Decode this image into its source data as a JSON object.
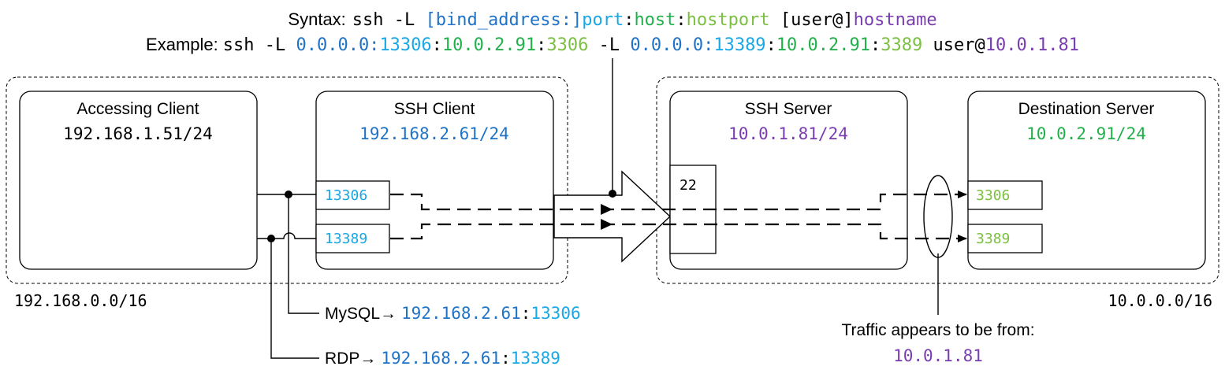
{
  "syntax": {
    "label": "Syntax:",
    "cmd": "ssh -L ",
    "bind_address": "[bind_address:]",
    "port": "port",
    "sep1": ":",
    "host": "host",
    "sep2": ":",
    "hostport": "hostport",
    "user": " [user@]",
    "hostname": "hostname"
  },
  "example": {
    "label": "Example:",
    "cmd1": "ssh -L ",
    "bind1": "0.0.0.0:",
    "port1": "13306",
    "sep1a": ":",
    "host1": "10.0.2.91",
    "sep1b": ":",
    "hostport1": "3306",
    "cmd2": " -L ",
    "bind2": "0.0.0.0:",
    "port2": "13389",
    "sep2a": ":",
    "host2": "10.0.2.91",
    "sep2b": ":",
    "hostport2": "3389",
    "user": " user@",
    "hostname": "10.0.1.81"
  },
  "networks": {
    "left": "192.168.0.0/16",
    "right": "10.0.0.0/16"
  },
  "nodes": {
    "accessing_client": {
      "title": "Accessing Client",
      "ip": "192.168.1.51/24"
    },
    "ssh_client": {
      "title": "SSH Client",
      "ip": "192.168.2.61/24",
      "port_a": "13306",
      "port_b": "13389"
    },
    "ssh_server": {
      "title": "SSH Server",
      "ip": "10.0.1.81/24",
      "port": "22"
    },
    "destination_server": {
      "title": "Destination Server",
      "ip": "10.0.2.91/24",
      "port_a": "3306",
      "port_b": "3389"
    }
  },
  "labels": {
    "mysql_prefix": "MySQL",
    "mysql_arrow": "→",
    "mysql_host": "192.168.2.61",
    "mysql_sep": ":",
    "mysql_port": "13306",
    "rdp_prefix": "RDP",
    "rdp_arrow": "→",
    "rdp_host": "192.168.2.61",
    "rdp_sep": ":",
    "rdp_port": "13389",
    "traffic_line": "Traffic appears to be from:",
    "traffic_ip": "10.0.1.81"
  },
  "colors": {
    "bind_address": "#1f73c7",
    "port": "#1aa7e6",
    "host": "#22b04c",
    "hostport": "#7cc043",
    "hostname": "#7a3db0"
  }
}
